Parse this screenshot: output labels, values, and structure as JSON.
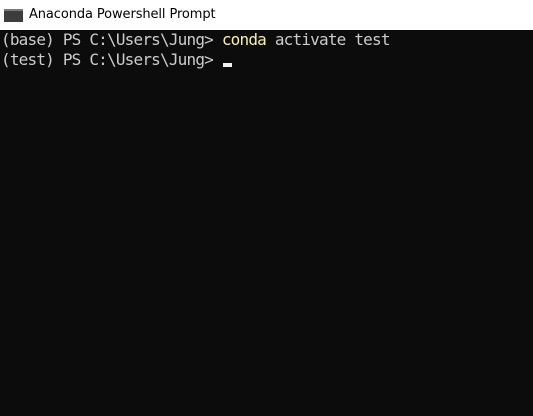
{
  "window": {
    "title": "Anaconda Powershell Prompt",
    "icon": "console-window-icon"
  },
  "console": {
    "lines": [
      {
        "prompt": "(base) PS C:\\Users\\Jung> ",
        "command": "conda",
        "args": " activate test"
      },
      {
        "prompt": "(test) PS C:\\Users\\Jung> ",
        "command": "",
        "args": ""
      }
    ],
    "colors": {
      "background": "#0c0c0c",
      "text": "#cccccc",
      "command": "#f9f1a5",
      "cursor": "#f2f2f2"
    }
  }
}
